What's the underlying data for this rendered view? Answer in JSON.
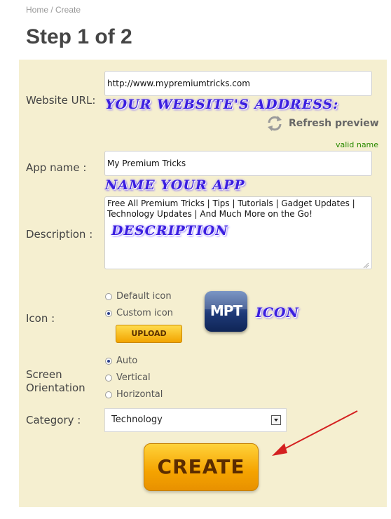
{
  "breadcrumb": "Home / Create",
  "page_title": "Step 1 of 2",
  "form": {
    "website_url": {
      "label": "Website URL:",
      "value": "http://www.mypremiumtricks.com",
      "annotation": "YOUR WEBSITE'S ADDRESS:"
    },
    "refresh_preview": "Refresh preview",
    "valid_name": "valid name",
    "app_name": {
      "label": "App name :",
      "value": "My Premium Tricks",
      "annotation": "NAME YOUR APP"
    },
    "description": {
      "label": "Description :",
      "value": "Free All Premium Tricks | Tips | Tutorials | Gadget Updates | Technology Updates | And Much More on the Go!",
      "annotation": "DESCRIPTION"
    },
    "icon": {
      "label": "Icon :",
      "options": [
        "Default icon",
        "Custom icon"
      ],
      "selected": "Custom icon",
      "upload_label": "UPLOAD",
      "preview_text": "MPT",
      "annotation": "ICON"
    },
    "orientation": {
      "label_line1": "Screen",
      "label_line2": "Orientation",
      "options": [
        "Auto",
        "Vertical",
        "Horizontal"
      ],
      "selected": "Auto"
    },
    "category": {
      "label": "Category :",
      "selected": "Technology"
    },
    "create_label": "CREATE"
  },
  "colors": {
    "panel_bg": "#f5efd0",
    "annotation": "#3a1ee0",
    "valid": "#2a8a00",
    "arrow": "#d42020"
  }
}
